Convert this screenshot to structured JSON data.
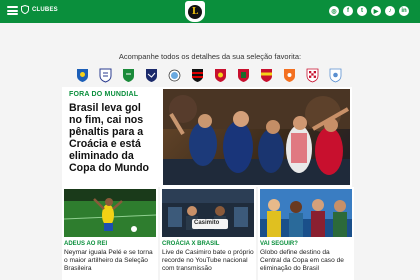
{
  "header": {
    "clubes_label": "CLUBES",
    "logo_letter": "L",
    "socials": [
      "ig",
      "fb",
      "tw",
      "yt",
      "tk",
      "in"
    ]
  },
  "colors": {
    "brand_green": "#0a8f3c",
    "text": "#111111"
  },
  "follow_text": "Acompanhe todos os detalhes da sua seleção favorita:",
  "teams": [
    "brazil",
    "england",
    "saudi-arabia",
    "france",
    "argentina",
    "germany",
    "belgium",
    "portugal",
    "spain",
    "netherlands",
    "croatia",
    "uruguay"
  ],
  "hero": {
    "tag": "FORA DO MUNDIAL",
    "title": "Brasil leva gol no fim, cai nos pênaltis para a Croácia e está eliminado da Copa do Mundo"
  },
  "cards": [
    {
      "tag": "ADEUS AO REI",
      "title": "Neymar iguala Pelé e se torna o maior artilheiro da Seleção Brasileira"
    },
    {
      "tag": "CROÁCIA X BRASIL",
      "title": "Live de Casimiro bate o próprio recorde no YouTube nacional com transmissão"
    },
    {
      "tag": "VAI SEGUIR?",
      "title": "Globo define destino da Central da Copa em caso de eliminação do Brasil"
    }
  ],
  "card2_overlay": "Casimito"
}
